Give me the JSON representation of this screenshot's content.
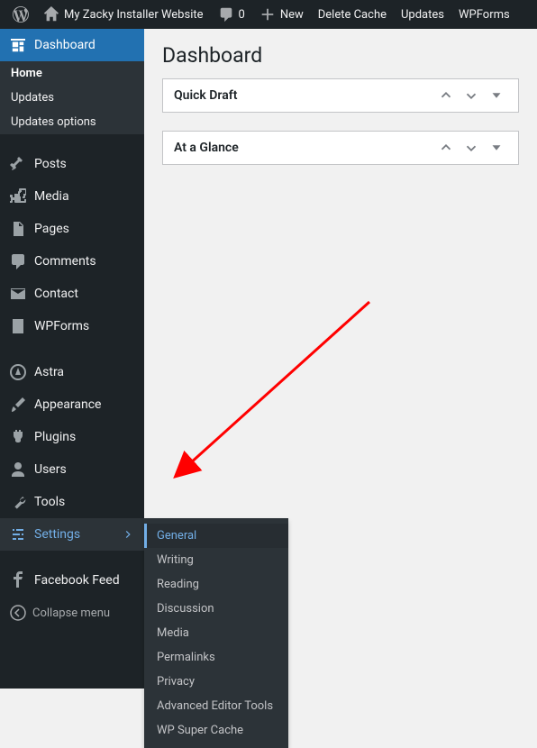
{
  "topbar": {
    "site_name": "My Zacky Installer Website",
    "comments_count": "0",
    "new_label": "New",
    "delete_cache": "Delete Cache",
    "updates": "Updates",
    "wpforms": "WPForms"
  },
  "sidebar": {
    "dashboard": {
      "label": "Dashboard",
      "submenu": [
        "Home",
        "Updates",
        "Updates options"
      ],
      "current": "Home"
    },
    "items": [
      {
        "id": "posts",
        "label": "Posts",
        "icon": "pin"
      },
      {
        "id": "media",
        "label": "Media",
        "icon": "media"
      },
      {
        "id": "pages",
        "label": "Pages",
        "icon": "pages"
      },
      {
        "id": "comments",
        "label": "Comments",
        "icon": "comments"
      },
      {
        "id": "contact",
        "label": "Contact",
        "icon": "mail"
      },
      {
        "id": "wpforms",
        "label": "WPForms",
        "icon": "form"
      }
    ],
    "items2": [
      {
        "id": "astra",
        "label": "Astra",
        "icon": "astra"
      },
      {
        "id": "appearance",
        "label": "Appearance",
        "icon": "brush"
      },
      {
        "id": "plugins",
        "label": "Plugins",
        "icon": "plug"
      },
      {
        "id": "users",
        "label": "Users",
        "icon": "user"
      },
      {
        "id": "tools",
        "label": "Tools",
        "icon": "wrench"
      },
      {
        "id": "settings",
        "label": "Settings",
        "icon": "sliders"
      }
    ],
    "items3": [
      {
        "id": "facebook-feed",
        "label": "Facebook Feed",
        "icon": "facebook"
      }
    ],
    "collapse_label": "Collapse menu"
  },
  "settings_flyout": [
    "General",
    "Writing",
    "Reading",
    "Discussion",
    "Media",
    "Permalinks",
    "Privacy",
    "Advanced Editor Tools",
    "WP Super Cache"
  ],
  "settings_flyout_current": "General",
  "main": {
    "page_title": "Dashboard",
    "boxes": [
      {
        "title": "Quick Draft"
      },
      {
        "title": "At a Glance"
      }
    ]
  }
}
